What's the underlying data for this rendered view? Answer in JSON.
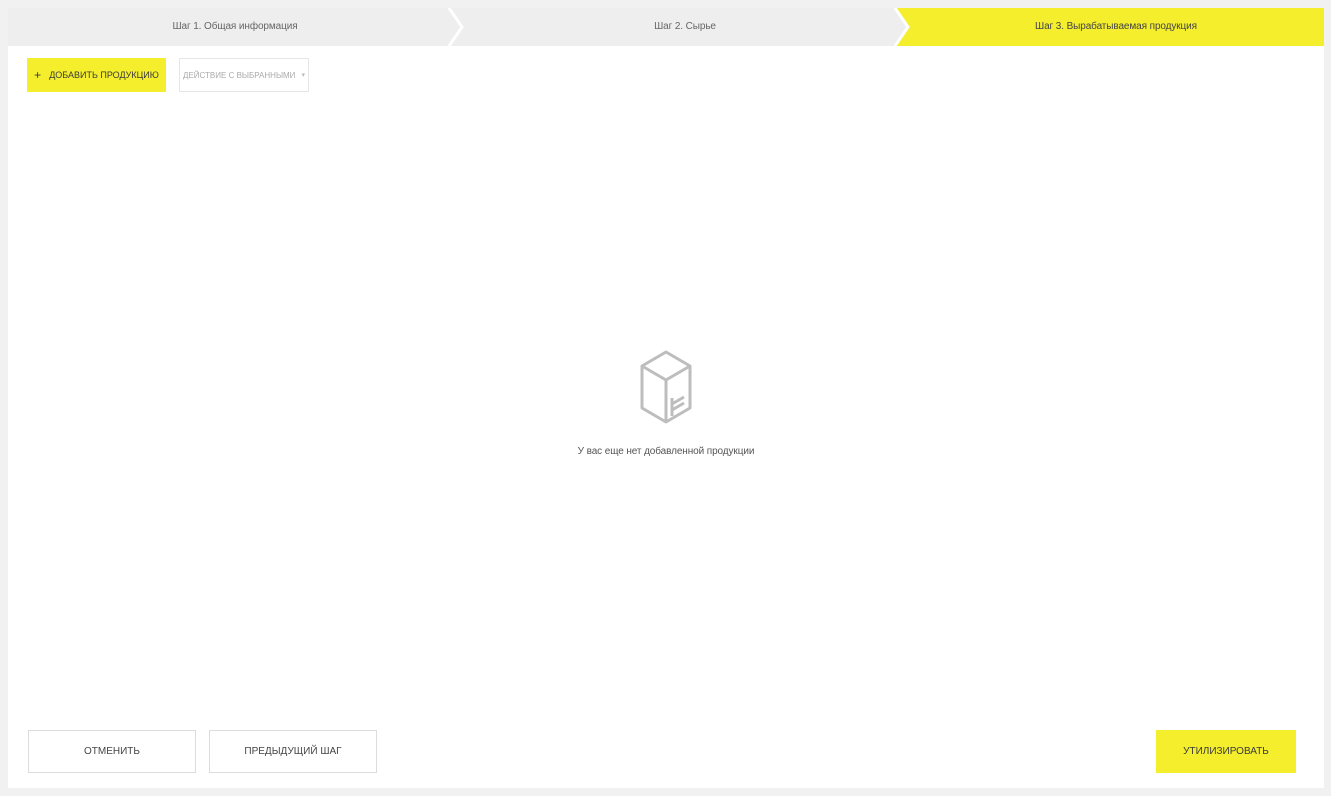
{
  "stepper": {
    "steps": [
      {
        "label": "Шаг 1. Общая информация",
        "state": "done"
      },
      {
        "label": "Шаг 2. Сырье",
        "state": "done"
      },
      {
        "label": "Шаг 3. Вырабатываемая продукция",
        "state": "active"
      }
    ],
    "colors": {
      "inactive": "#eeeeee",
      "active": "#f4ee2d",
      "separator": "#ffffff"
    }
  },
  "toolbar": {
    "add_icon": "+",
    "add_label": "Добавить продукцию",
    "actions_label": "Действие с выбранными",
    "actions_chevron": "▾"
  },
  "empty_state": {
    "icon": "box-icon",
    "text": "У вас еще нет добавленной продукции"
  },
  "footer": {
    "cancel_label": "Отменить",
    "prev_label": "Предыдущий шаг",
    "submit_label": "Утилизировать"
  },
  "colors": {
    "accent": "#f4ee2d",
    "background": "#f1f1f1"
  }
}
